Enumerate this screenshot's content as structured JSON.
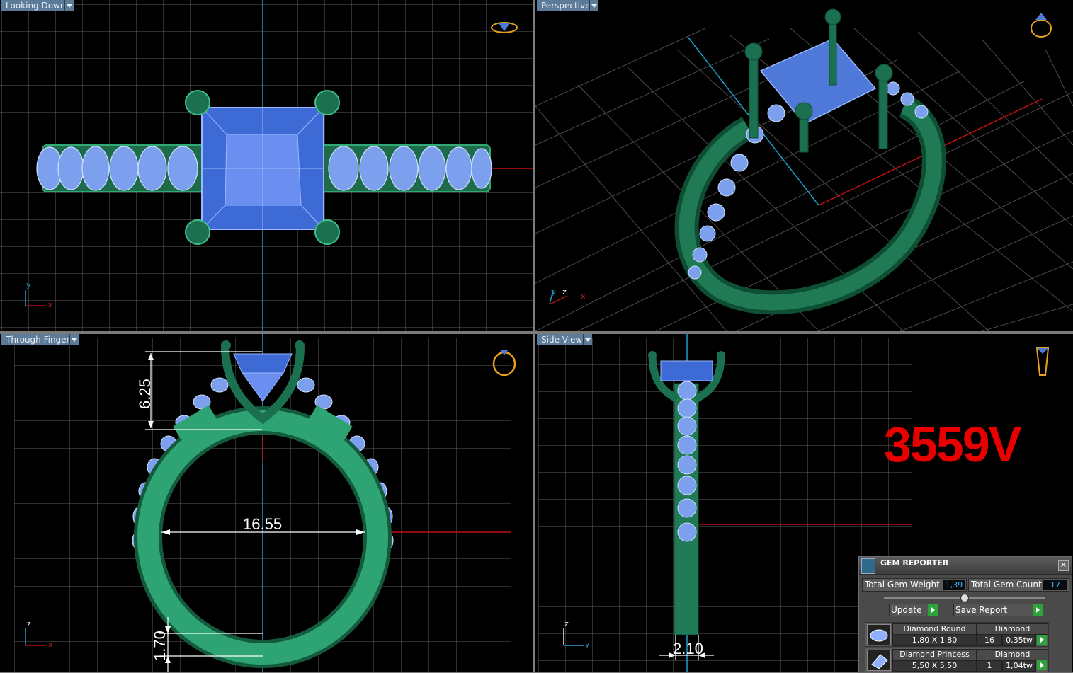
{
  "viewports": {
    "top_left": {
      "label": "Looking Down"
    },
    "top_right": {
      "label": "Perspective"
    },
    "bottom_left": {
      "label": "Through Finger"
    },
    "bottom_right": {
      "label": "Side View"
    }
  },
  "axis_labels": {
    "x": "x",
    "y": "y",
    "z": "z"
  },
  "dimensions": {
    "height": "6.25",
    "inner_diameter": "16.55",
    "band_thickness": "1.70",
    "band_width": "2.10"
  },
  "model_code": "3559V",
  "colors": {
    "metal": "#1f7a55",
    "gem": "#4f79d8",
    "accent_code": "#e60000",
    "viewport_tab": "#5c7b99"
  },
  "gem_reporter": {
    "title": "GEM REPORTER",
    "total_weight_label": "Total Gem Weight",
    "total_weight_value": "1,39",
    "total_count_label": "Total Gem Count",
    "total_count_value": "17",
    "update_label": "Update",
    "save_label": "Save Report",
    "gems": [
      {
        "name": "Diamond Round",
        "material": "Diamond",
        "size": "1,80 X 1,80",
        "count": "16",
        "weight": "0,35tw"
      },
      {
        "name": "Diamond Princess",
        "material": "Diamond",
        "size": "5,50 X 5,50",
        "count": "1",
        "weight": "1,04tw"
      }
    ]
  }
}
